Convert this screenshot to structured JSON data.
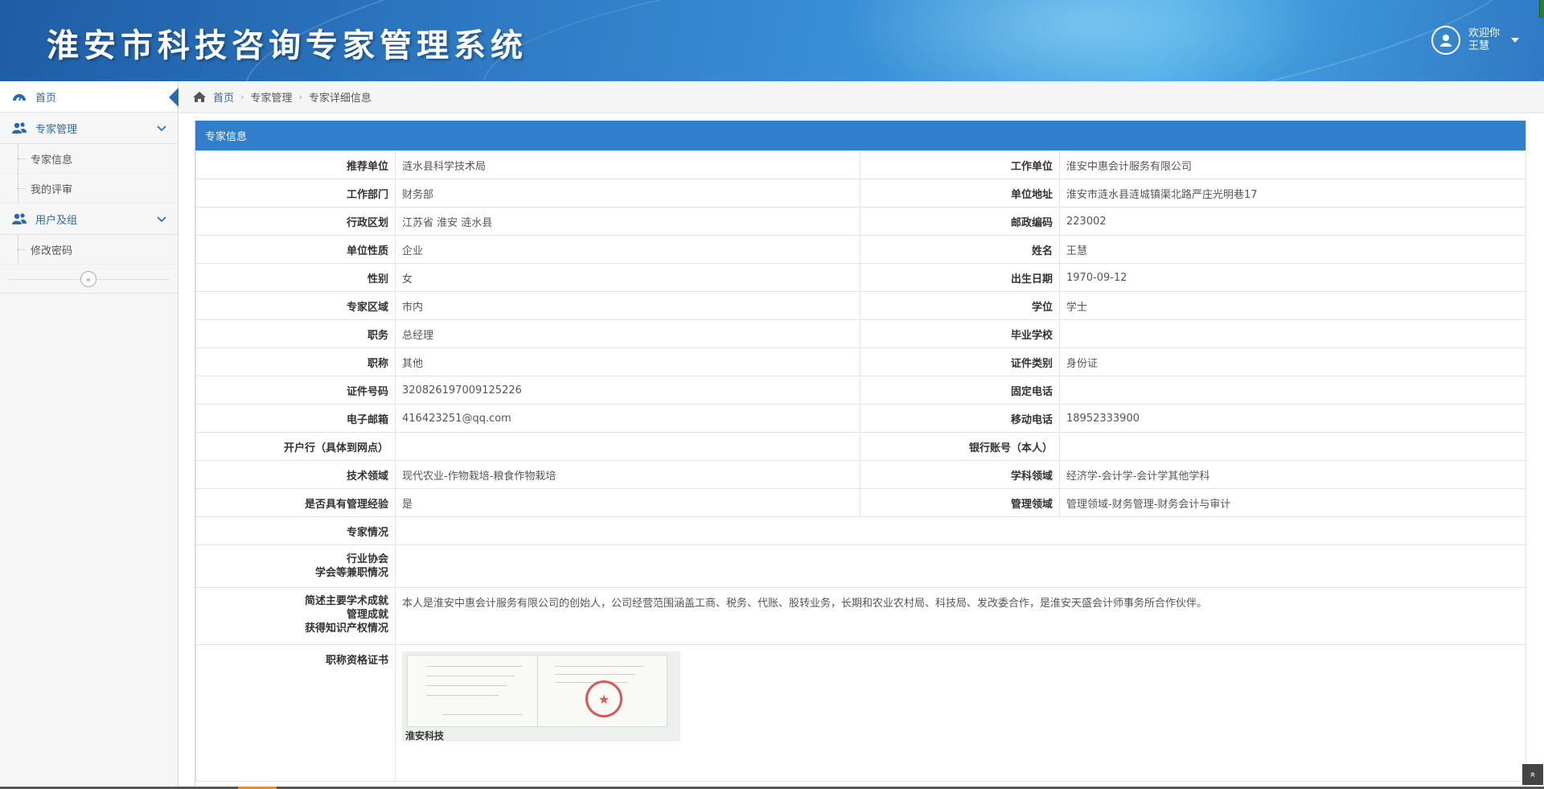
{
  "header": {
    "title": "淮安市科技咨询专家管理系统",
    "welcome": "欢迎你",
    "username": "王慧"
  },
  "sidebar": {
    "items": [
      {
        "label": "首页",
        "icon": "dashboard-icon",
        "active": true
      },
      {
        "label": "专家管理",
        "icon": "users-icon",
        "children": [
          "专家信息",
          "我的评审"
        ]
      },
      {
        "label": "用户及组",
        "icon": "users-icon",
        "children": [
          "修改密码"
        ]
      }
    ],
    "collapse_symbol": "«"
  },
  "breadcrumb": {
    "home": "首页",
    "level1": "专家管理",
    "level2": "专家详细信息"
  },
  "panel": {
    "title": "专家信息",
    "pair_rows": [
      {
        "l1": "推荐单位",
        "v1": "涟水县科学技术局",
        "l2": "工作单位",
        "v2": "淮安中惠会计服务有限公司"
      },
      {
        "l1": "工作部门",
        "v1": "财务部",
        "l2": "单位地址",
        "v2": "淮安市涟水县涟城镇渠北路严庄光明巷17"
      },
      {
        "l1": "行政区划",
        "v1": "江苏省 淮安 涟水县",
        "l2": "邮政编码",
        "v2": "223002"
      },
      {
        "l1": "单位性质",
        "v1": "企业",
        "l2": "姓名",
        "v2": "王慧"
      },
      {
        "l1": "性别",
        "v1": "女",
        "l2": "出生日期",
        "v2": "1970-09-12"
      },
      {
        "l1": "专家区域",
        "v1": "市内",
        "l2": "学位",
        "v2": "学士"
      },
      {
        "l1": "职务",
        "v1": "总经理",
        "l2": "毕业学校",
        "v2": ""
      },
      {
        "l1": "职称",
        "v1": "其他",
        "l2": "证件类别",
        "v2": "身份证"
      },
      {
        "l1": "证件号码",
        "v1": "320826197009125226",
        "l2": "固定电话",
        "v2": ""
      },
      {
        "l1": "电子邮箱",
        "v1": "416423251@qq.com",
        "l2": "移动电话",
        "v2": "18952333900"
      },
      {
        "l1": "开户行（具体到网点）",
        "v1": "",
        "l2": "银行账号（本人）",
        "v2": ""
      },
      {
        "l1": "技术领域",
        "v1": "现代农业-作物栽培-粮食作物栽培",
        "l2": "学科领域",
        "v2": "经济学-会计学-会计学其他学科"
      },
      {
        "l1": "是否具有管理经验",
        "v1": "是",
        "l2": "管理领域",
        "v2": "管理领域-财务管理-财务会计与审计"
      }
    ],
    "expert_situation_label": "专家情况",
    "expert_situation_value": "",
    "association_label_1": "行业协会",
    "association_label_2": "学会等兼职情况",
    "association_value": "",
    "achievement_label_1": "简述主要学术成就",
    "achievement_label_2": "管理成就",
    "achievement_label_3": "获得知识产权情况",
    "achievement_value": "本人是淮安中惠会计服务有限公司的创始人，公司经营范围涵盖工商、税务、代账、股转业务，长期和农业农村局、科技局、发改委合作，是淮安天盛会计师事务所合作伙伴。",
    "certificate_label": "职称资格证书",
    "certificate_watermark": "淮安科技"
  },
  "back_to_top_symbol": "»",
  "colors": {
    "panel_header": "#307ecc",
    "link": "#2a6aa8"
  }
}
